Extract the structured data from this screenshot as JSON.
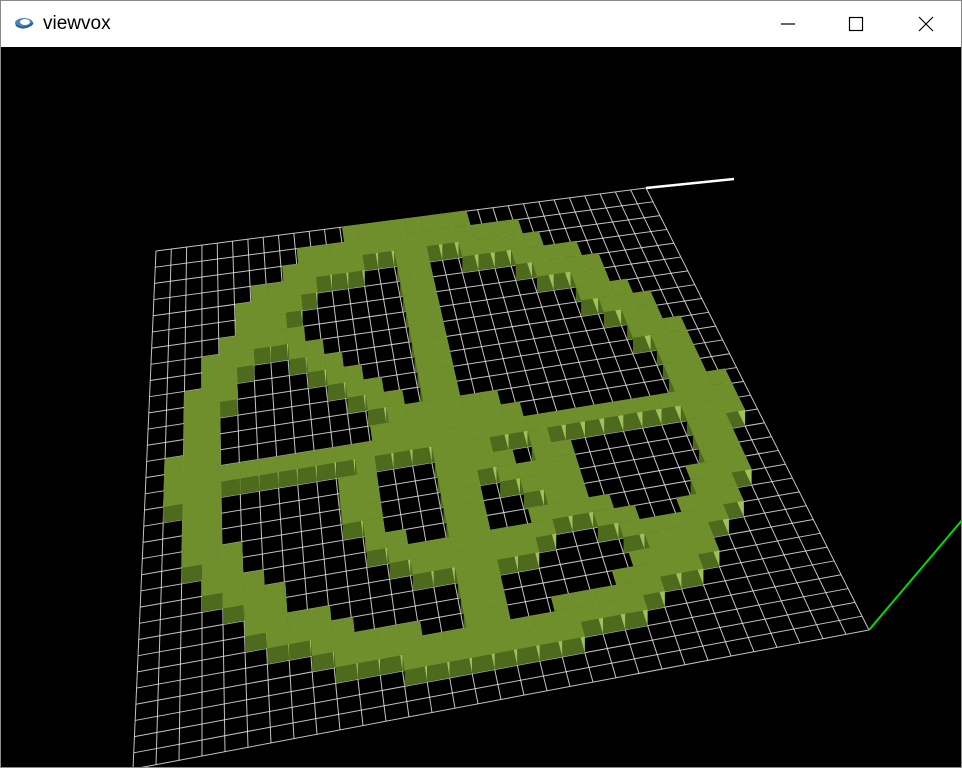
{
  "window": {
    "title": "viewvox",
    "app_icon": "viewvox-app-icon",
    "controls": [
      "minimize",
      "maximize",
      "close"
    ]
  },
  "viewport": {
    "background": "#000000",
    "grid_color": "#e6e6e6",
    "voxel_top_color": "#6f8f2c",
    "voxel_side_light": "#9fc05a",
    "voxel_side_dark": "#4e6a1c",
    "x_axis_color": "#ffffff",
    "y_axis_color": "#00e000"
  }
}
